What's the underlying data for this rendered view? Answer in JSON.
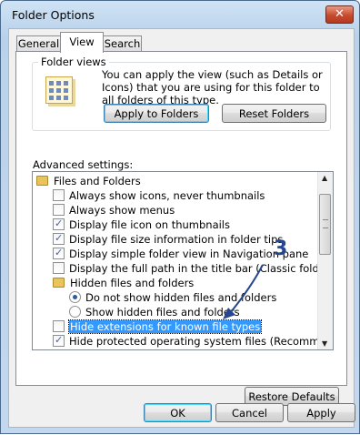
{
  "window": {
    "title": "Folder Options",
    "close_glyph": "✕"
  },
  "tabs": [
    {
      "label": "General",
      "active": false
    },
    {
      "label": "View",
      "active": true
    },
    {
      "label": "Search",
      "active": false
    }
  ],
  "folder_views": {
    "group_label": "Folder views",
    "description": "You can apply the view (such as Details or Icons) that you are using for this folder to all folders of this type.",
    "apply_button": "Apply to Folders",
    "reset_button": "Reset Folders"
  },
  "advanced": {
    "label": "Advanced settings:",
    "items": [
      {
        "type": "folder",
        "label": "Files and Folders",
        "indent": 0,
        "checked": false,
        "selected": false
      },
      {
        "type": "checkbox",
        "label": "Always show icons, never thumbnails",
        "indent": 1,
        "checked": false,
        "selected": false
      },
      {
        "type": "checkbox",
        "label": "Always show menus",
        "indent": 1,
        "checked": false,
        "selected": false
      },
      {
        "type": "checkbox",
        "label": "Display file icon on thumbnails",
        "indent": 1,
        "checked": true,
        "selected": false
      },
      {
        "type": "checkbox",
        "label": "Display file size information in folder tips",
        "indent": 1,
        "checked": true,
        "selected": false
      },
      {
        "type": "checkbox",
        "label": "Display simple folder view in Navigation pane",
        "indent": 1,
        "checked": true,
        "selected": false
      },
      {
        "type": "checkbox",
        "label": "Display the full path in the title bar (Classic folders only)",
        "indent": 1,
        "checked": false,
        "selected": false
      },
      {
        "type": "folder",
        "label": "Hidden files and folders",
        "indent": 1,
        "checked": false,
        "selected": false
      },
      {
        "type": "radio",
        "label": "Do not show hidden files and folders",
        "indent": 2,
        "checked": true,
        "selected": false
      },
      {
        "type": "radio",
        "label": "Show hidden files and folders",
        "indent": 2,
        "checked": false,
        "selected": false
      },
      {
        "type": "checkbox",
        "label": "Hide extensions for known file types",
        "indent": 1,
        "checked": false,
        "selected": true
      },
      {
        "type": "checkbox",
        "label": "Hide protected operating system files (Recommended)",
        "indent": 1,
        "checked": true,
        "selected": false
      }
    ]
  },
  "annotation": {
    "number": "3",
    "color": "#26468e"
  },
  "buttons": {
    "restore_defaults": "Restore Defaults",
    "ok": "OK",
    "cancel": "Cancel",
    "apply": "Apply"
  },
  "colors": {
    "selection": "#3399ff",
    "accent_border": "#3c7fb1"
  }
}
